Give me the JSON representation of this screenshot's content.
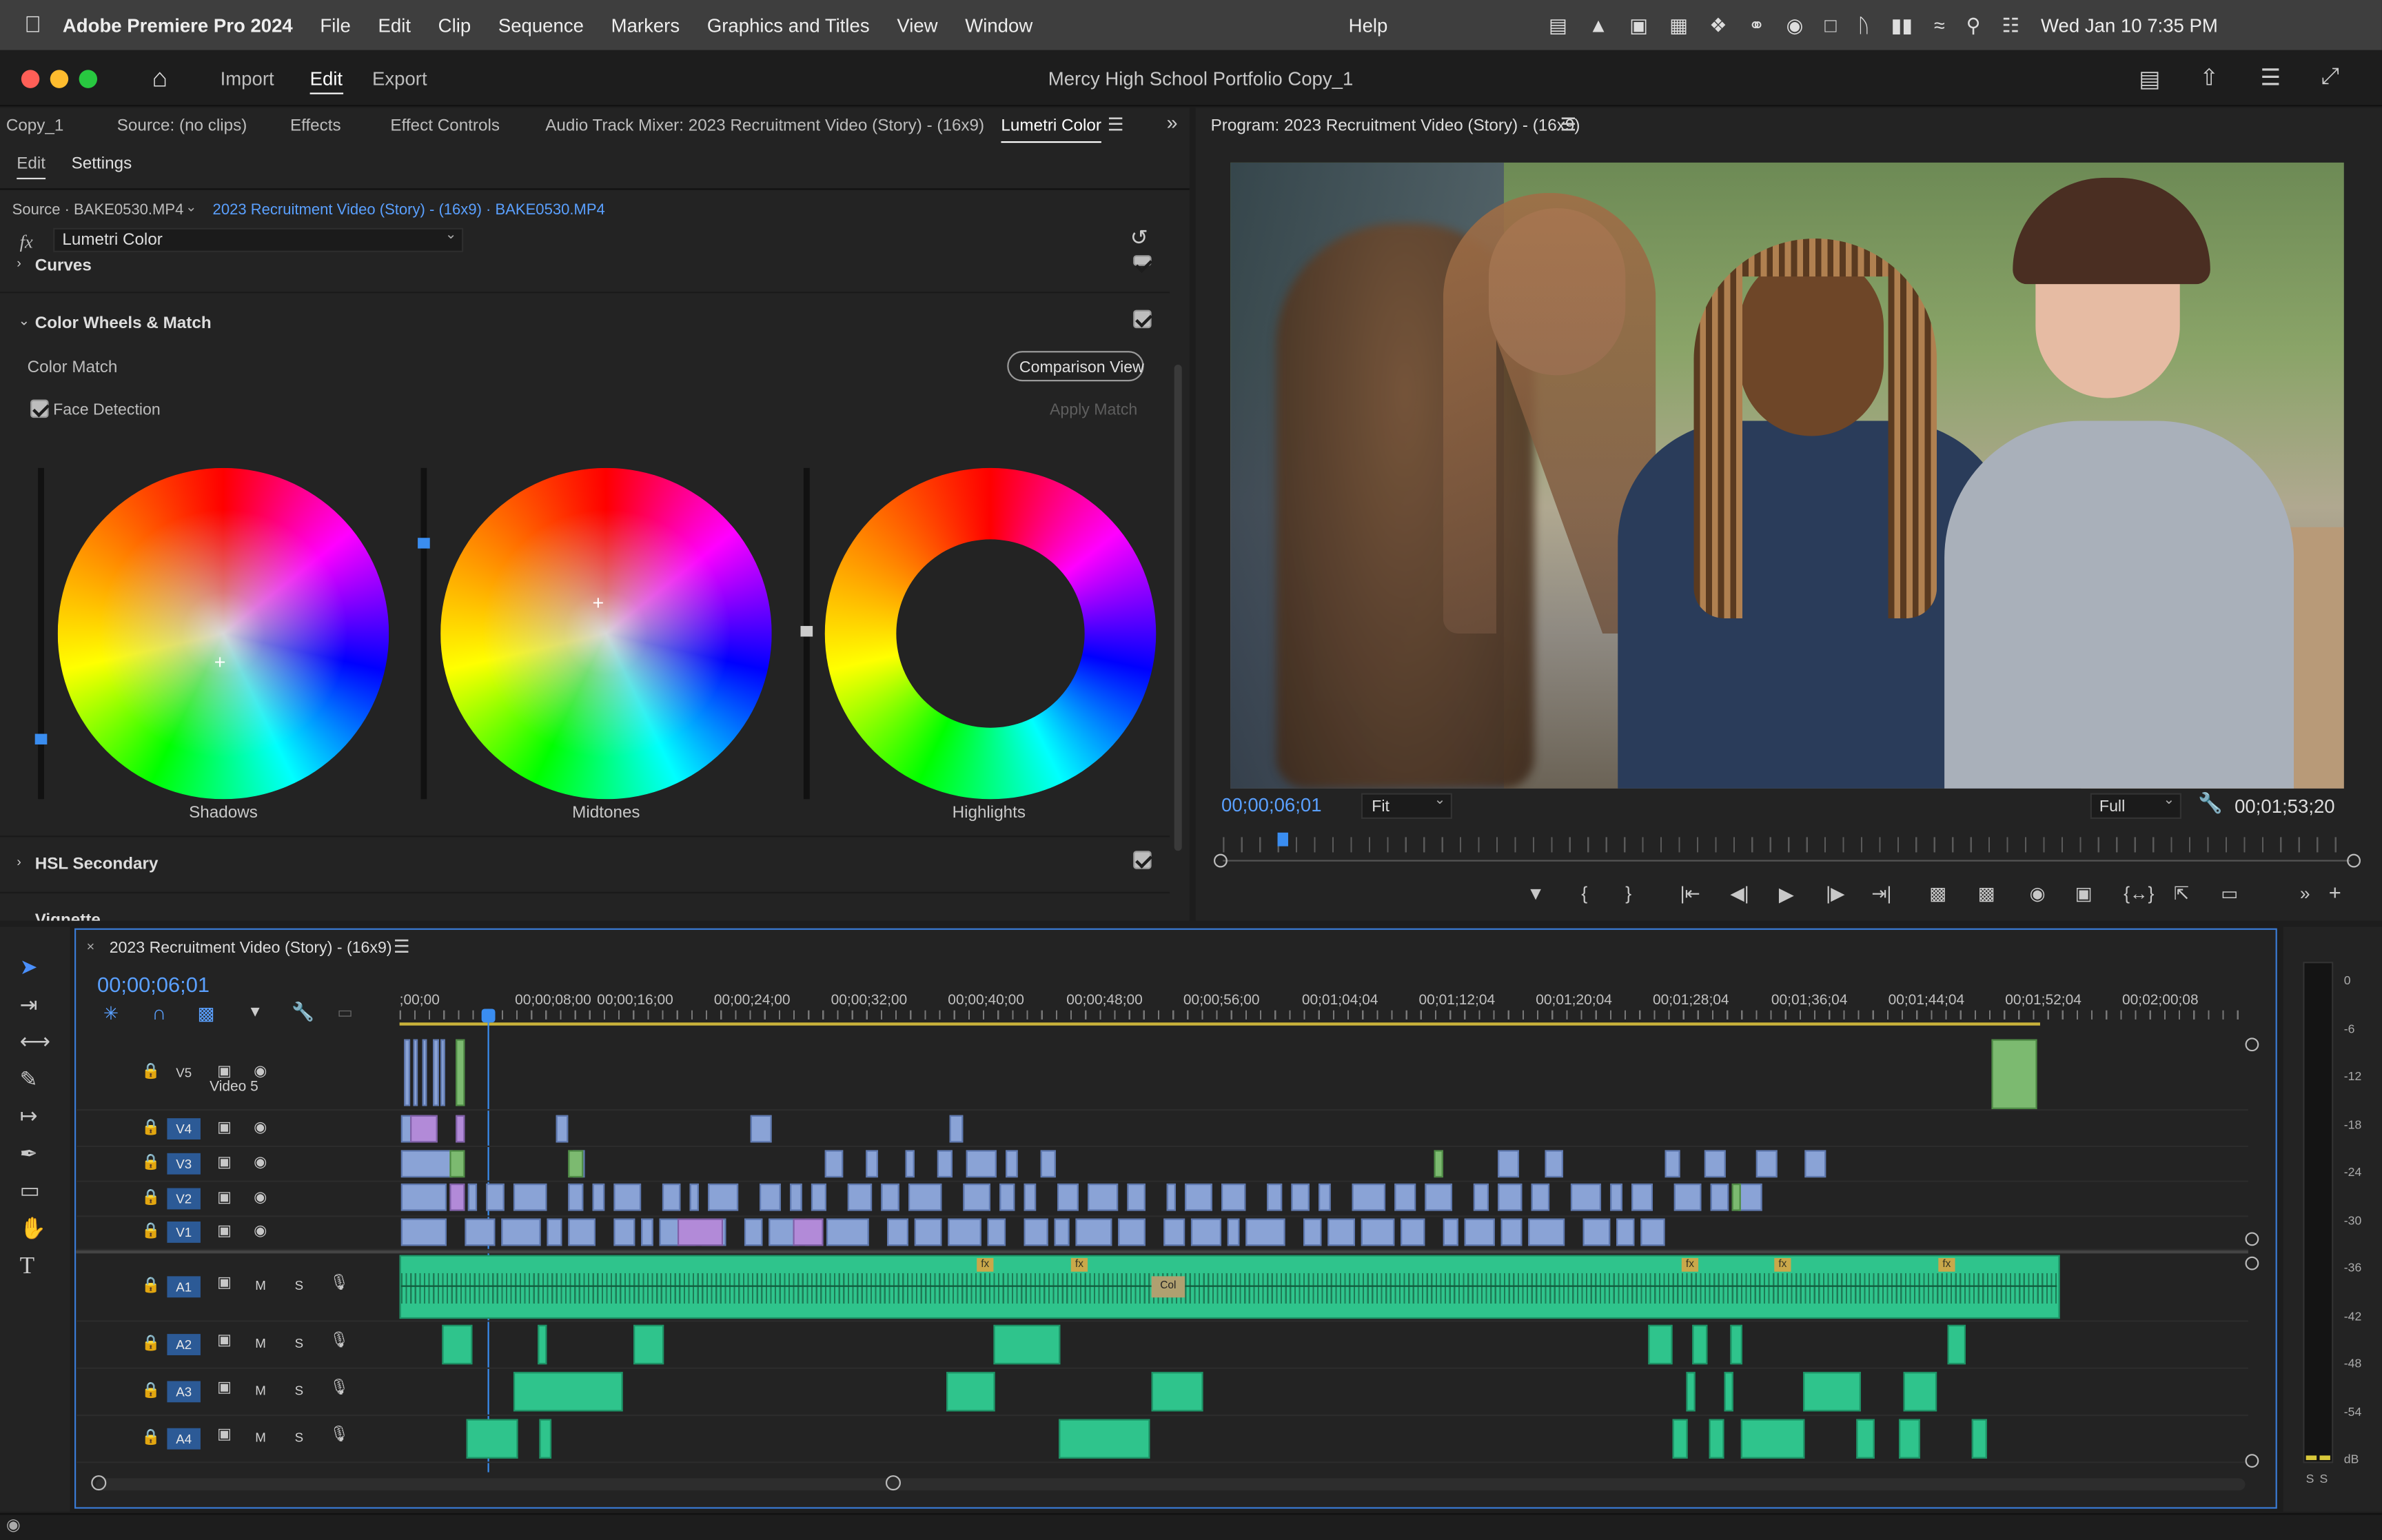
{
  "menu": {
    "apple": "",
    "app": "Adobe Premiere Pro 2024",
    "items": [
      "File",
      "Edit",
      "Clip",
      "Sequence",
      "Markers",
      "Graphics and Titles",
      "View",
      "Window"
    ],
    "help": "Help",
    "datetime": "Wed Jan 10  7:35 PM"
  },
  "workspace": {
    "tabs": [
      "Import",
      "Edit",
      "Export"
    ],
    "active": "Edit",
    "project_title": "Mercy High School Portfolio Copy_1"
  },
  "left_tabs": [
    "Copy_1",
    "Source: (no clips)",
    "Effects",
    "Effect Controls",
    "Audio Track Mixer: 2023 Recruitment Video (Story) - (16x9)",
    "Lumetri Color"
  ],
  "lumetri": {
    "subtabs": [
      "Edit",
      "Settings"
    ],
    "source_label": "Source · BAKE0530.MP4",
    "source_path": "2023 Recruitment Video (Story) - (16x9) · BAKE0530.MP4",
    "fx_symbol": "fx",
    "effect": "Lumetri Color",
    "curves": "Curves",
    "wheels_section": "Color Wheels & Match",
    "color_match": "Color Match",
    "comparison_view": "Comparison View",
    "face_detection": "Face Detection",
    "apply_match": "Apply Match",
    "wheels": [
      "Shadows",
      "Midtones",
      "Highlights"
    ],
    "hsl": "HSL Secondary",
    "vignette": "Vignette"
  },
  "program": {
    "title": "Program: 2023 Recruitment Video (Story) - (16x9)",
    "timecode": "00;00;06;01",
    "fit": "Fit",
    "full": "Full",
    "duration": "00;01;53;20",
    "playhead_fraction": 0.053
  },
  "timeline": {
    "tab_title": "2023 Recruitment Video (Story) - (16x9)",
    "timecode": "00;00;06;01",
    "ruler": [
      ";00;00",
      "00;00;08;00",
      "00;00;16;00",
      "00;00;24;00",
      "00;00;32;00",
      "00;00;40;00",
      "00;00;48;00",
      "00;00;56;00",
      "00;01;04;04",
      "00;01;12;04",
      "00;01;20;04",
      "00;01;28;04",
      "00;01;36;04",
      "00;01;44;04",
      "00;01;52;04",
      "00;02;00;08"
    ],
    "video_tracks": [
      {
        "id": "V5",
        "name": "Video 5"
      },
      {
        "id": "V4"
      },
      {
        "id": "V3"
      },
      {
        "id": "V2"
      },
      {
        "id": "V1"
      }
    ],
    "audio_tracks": [
      "A1",
      "A2",
      "A3",
      "A4"
    ],
    "mute": "M",
    "solo": "S",
    "fx_tag": "fx",
    "col_tag": "Col"
  },
  "meter": {
    "scale": [
      "0",
      "-6",
      "-12",
      "-18",
      "-24",
      "-30",
      "-36",
      "-42",
      "-48",
      "-54",
      "dB"
    ],
    "solo_labels": [
      "S",
      "S"
    ]
  }
}
